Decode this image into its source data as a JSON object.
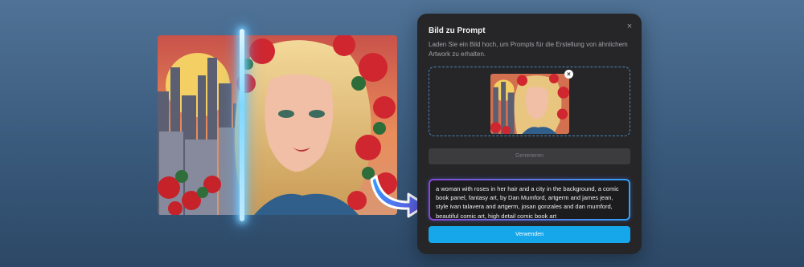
{
  "dialog": {
    "title": "Bild zu Prompt",
    "description": "Laden Sie ein Bild hoch, um Prompts für die Erstellung von ähnlichem Artwork zu erhalten.",
    "close_icon": "×"
  },
  "upload": {
    "remove_icon": "×"
  },
  "buttons": {
    "generate_label": "Generieren",
    "use_label": "Verwenden"
  },
  "prompt": {
    "text": "a woman with roses in her hair and a city in the background, a comic book panel, fantasy art, by Dan Mumford, artgerm and james jean, style ivan talavera and artgerm, josan gonzales and dan mumford, beautiful comic art, high detail comic book art"
  },
  "colors": {
    "accent": "#16a7ea",
    "panel": "#262628",
    "gradient_start": "#8a46d8",
    "gradient_end": "#2ea3ff"
  }
}
